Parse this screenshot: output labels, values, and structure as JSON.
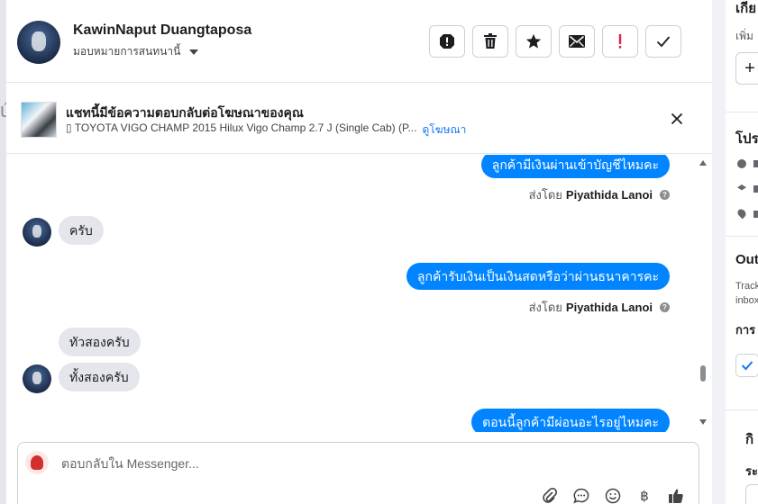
{
  "header": {
    "contact_name": "KawinNaput Duangtaposa",
    "assign_label": "มอบหมายการสนทนานี้",
    "actions": [
      "spam-icon",
      "trash-icon",
      "star-icon",
      "mail-icon",
      "important-icon",
      "check-icon"
    ]
  },
  "ad_banner": {
    "title": "แชทนี้มีข้อความตอบกลับต่อโฆษณาของคุณ",
    "subtitle": "▯ TOYOTA VIGO CHAMP 2015 Hilux Vigo Champ 2.7 J (Single Cab) (P...",
    "link": "ดูโฆษณา"
  },
  "messages": [
    {
      "direction": "out",
      "text": "ลูกค้ามีเงินผ่านเข้าบัญชีไหมคะ"
    },
    {
      "sent_by_prefix": "ส่งโดย",
      "sent_by_name": "Piyathida Lanoi"
    },
    {
      "direction": "in",
      "text": "ครับ"
    },
    {
      "direction": "out",
      "text": "ลูกค้ารับเงินเป็นเงินสดหรือว่าผ่านธนาคารคะ"
    },
    {
      "sent_by_prefix": "ส่งโดย",
      "sent_by_name": "Piyathida Lanoi"
    },
    {
      "direction": "in",
      "text": "ทัวสองครับ"
    },
    {
      "direction": "in",
      "text": "ทั้งสองครับ"
    },
    {
      "direction": "out",
      "text": "ตอนนี้ลูกค้ามีผ่อนอะไรอยู่ไหมคะ"
    }
  ],
  "composer": {
    "placeholder": "ตอบกลับใน Messenger...",
    "tools": [
      "attach-icon",
      "chat-icon",
      "emoji-icon",
      "baht-icon",
      "thumbs-up-icon"
    ],
    "baht_symbol": "฿"
  },
  "right_panel": {
    "t1": "เกีย",
    "t2": "เพิ่ม",
    "t3": "+",
    "t4": "โปร",
    "t5": "Out",
    "t6": "Track",
    "t7": "inbox",
    "t8": "การ",
    "t9": "กิ",
    "t10": "ระ"
  },
  "colors": {
    "accent": "#0084ff",
    "link": "#1877f2",
    "bubble_in": "#e4e6eb"
  }
}
